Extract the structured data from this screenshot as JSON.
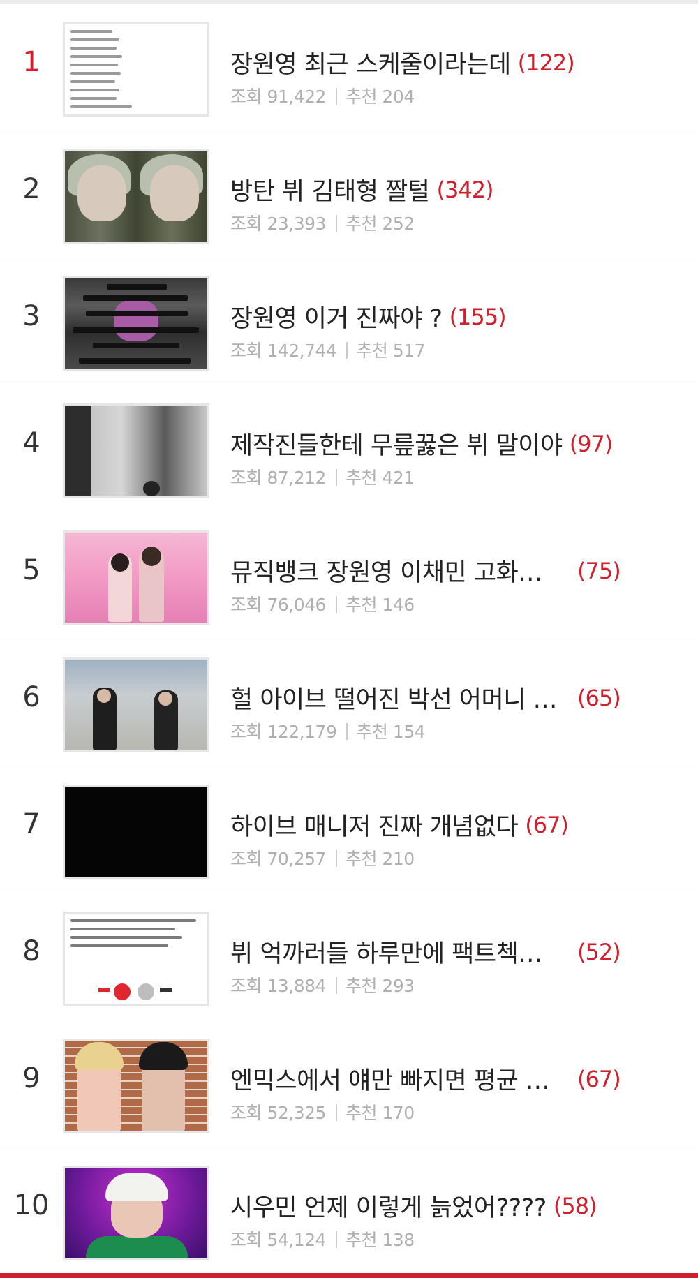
{
  "items": [
    {
      "rank": "1",
      "title": "장원영 최근 스케줄이라는데",
      "comments": "(122)",
      "views_label": "조회",
      "views": "91,422",
      "recommend_label": "추천",
      "recommends": "204",
      "thumb": "doc"
    },
    {
      "rank": "2",
      "title": "방탄 뷔 김태형 짤털",
      "comments": "(342)",
      "views_label": "조회",
      "views": "23,393",
      "recommend_label": "추천",
      "recommends": "252",
      "thumb": "kim"
    },
    {
      "rank": "3",
      "title": "장원영 이거 진짜야 ?",
      "comments": "(155)",
      "views_label": "조회",
      "views": "142,744",
      "recommend_label": "추천",
      "recommends": "517",
      "thumb": "jang"
    },
    {
      "rank": "4",
      "title": "제작진들한테 무릎꿇은 뷔 말이야",
      "comments": "(97)",
      "views_label": "조회",
      "views": "87,212",
      "recommend_label": "추천",
      "recommends": "421",
      "thumb": "stage"
    },
    {
      "rank": "5",
      "title": "뮤직뱅크 장원영 이채민 고화질 …",
      "comments": "(75)",
      "views_label": "조회",
      "views": "76,046",
      "recommend_label": "추천",
      "recommends": "146",
      "thumb": "mbank"
    },
    {
      "rank": "6",
      "title": "헐 아이브 떨어진 박선 어머니 댓…",
      "comments": "(65)",
      "views_label": "조회",
      "views": "122,179",
      "recommend_label": "추천",
      "recommends": "154",
      "thumb": "ive"
    },
    {
      "rank": "7",
      "title": "하이브 매니저 진짜 개념없다",
      "comments": "(67)",
      "views_label": "조회",
      "views": "70,257",
      "recommend_label": "추천",
      "recommends": "210",
      "thumb": "black"
    },
    {
      "rank": "8",
      "title": "뷔 억까러들 하루만에 팩트첵크 …",
      "comments": "(52)",
      "views_label": "조회",
      "views": "13,884",
      "recommend_label": "추천",
      "recommends": "293",
      "thumb": "comment"
    },
    {
      "rank": "9",
      "title": "엔믹스에서 얘만 빠지면 평균 비…",
      "comments": "(67)",
      "views_label": "조회",
      "views": "52,325",
      "recommend_label": "추천",
      "recommends": "170",
      "thumb": "brick"
    },
    {
      "rank": "10",
      "title": "시우민 언제 이렇게 늙었어????",
      "comments": "(58)",
      "views_label": "조회",
      "views": "54,124",
      "recommend_label": "추천",
      "recommends": "138",
      "thumb": "xiu"
    }
  ],
  "colors": {
    "accent": "#d0202e",
    "title_text": "#222222",
    "meta_text": "#b0b0b0",
    "divider": "#e2e2e2"
  }
}
